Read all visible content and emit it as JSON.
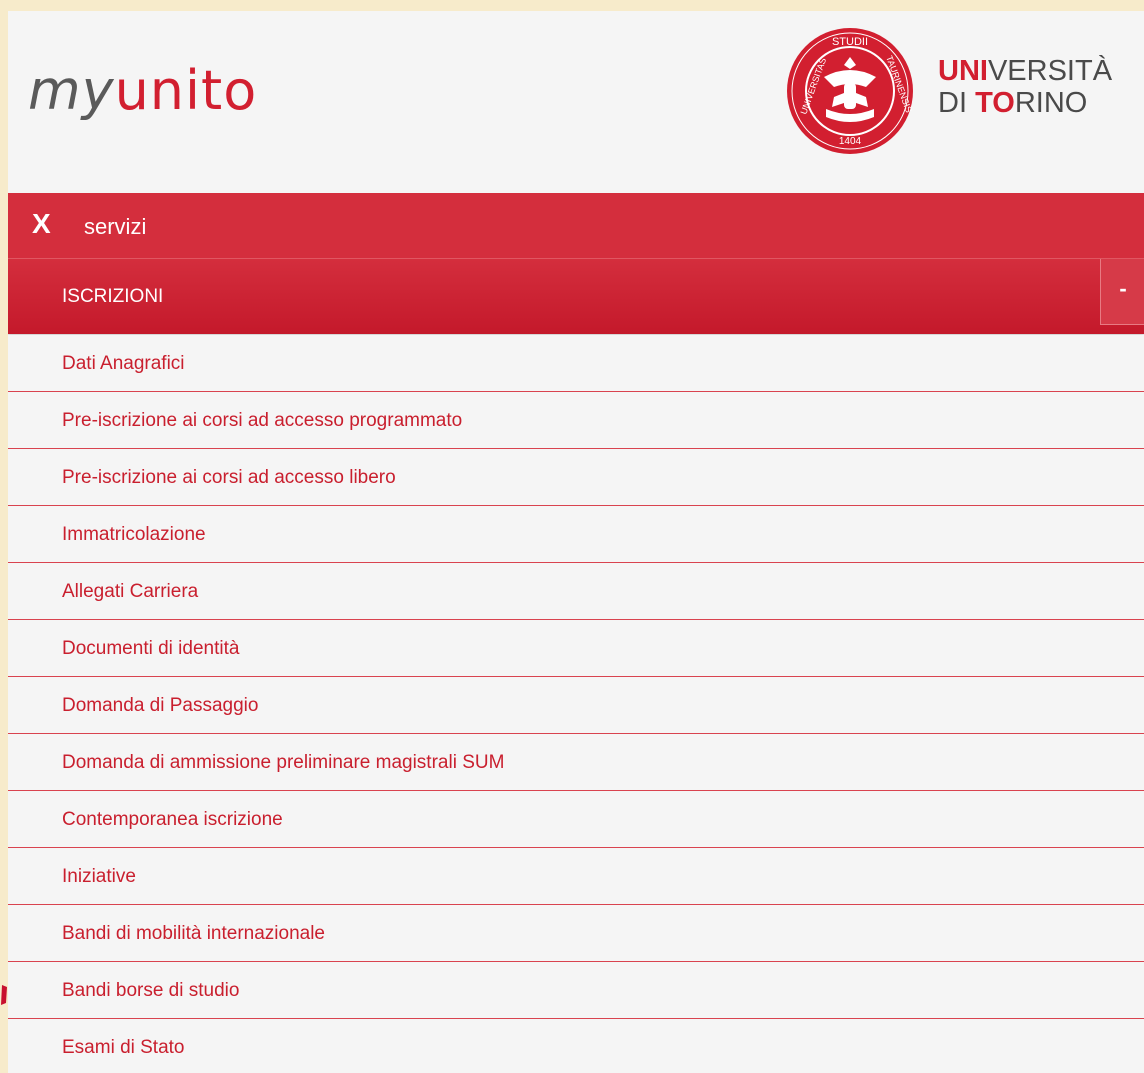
{
  "header": {
    "brand_my": "my",
    "brand_unito": "unito",
    "university_line1_red": "UNI",
    "university_line1_rest": "VERSITÀ",
    "university_line2_pre": "DI ",
    "university_line2_red": "TO",
    "university_line2_rest": "RINO",
    "seal_text_top": "STUDII",
    "seal_text_left": "UNIVERSITAS",
    "seal_text_right": "TAURINENSIS",
    "seal_year": "1404"
  },
  "topbar": {
    "close_label": "X",
    "title": "servizi"
  },
  "section": {
    "title": "ISCRIZIONI",
    "collapse_label": "-"
  },
  "menu": {
    "items": [
      "Dati Anagrafici",
      "Pre-iscrizione ai corsi ad accesso programmato",
      "Pre-iscrizione ai corsi ad accesso libero",
      "Immatricolazione",
      "Allegati Carriera",
      "Documenti di identità",
      "Domanda di Passaggio",
      "Domanda di ammissione preliminare magistrali SUM",
      "Contemporanea iscrizione",
      "Iniziative",
      "Bandi di mobilità internazionale",
      "Bandi borse di studio",
      "Esami di Stato"
    ]
  },
  "colors": {
    "brand_red": "#d21f30",
    "bar_red": "#d42e3d",
    "menu_text": "#c91f2e",
    "background": "#f5f5f5",
    "outer_background": "#f7ebcb"
  }
}
